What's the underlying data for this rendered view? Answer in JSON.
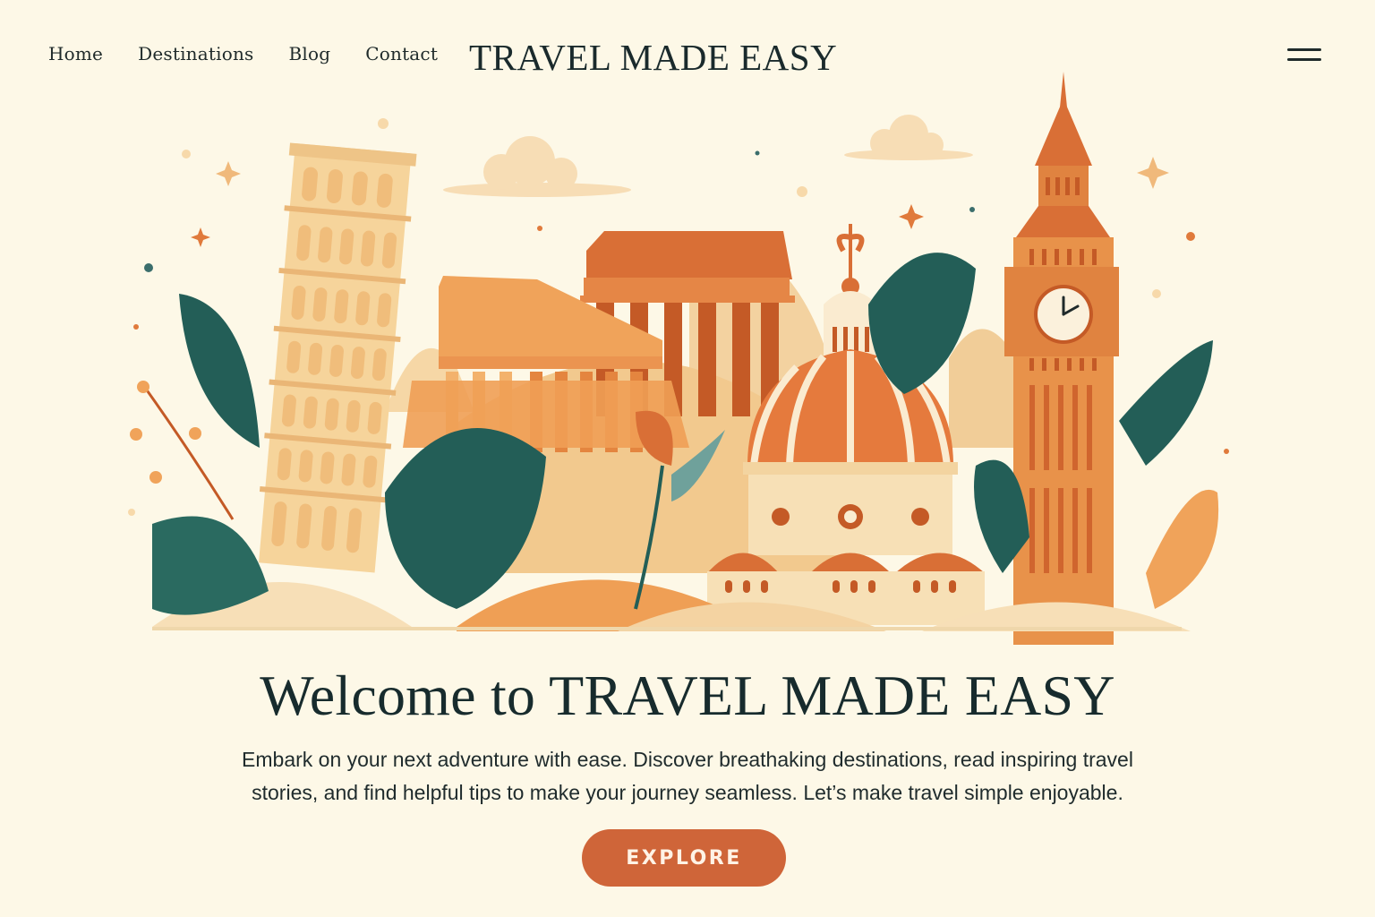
{
  "nav": {
    "items": [
      {
        "label": "Home"
      },
      {
        "label": "Destinations"
      },
      {
        "label": "Blog"
      },
      {
        "label": "Contact"
      }
    ]
  },
  "header": {
    "brand": "TRAVEL MADE EASY",
    "menu_icon": "hamburger-menu-icon"
  },
  "hero": {
    "illustration": "travel-landmarks-illustration",
    "headline": "Welcome to TRAVEL MADE EASY",
    "subtext": "Embark on your next adventure with ease. Discover breathaking destinations, read inspiring travel stories, and find helpful tips to make your journey seamless. Let’s make travel simple enjoyable.",
    "cta_label": "EXPLORE"
  },
  "colors": {
    "background": "#fdf8e7",
    "accent": "#cf6539",
    "text": "#1d2b2c",
    "leaf": "#235e57"
  }
}
